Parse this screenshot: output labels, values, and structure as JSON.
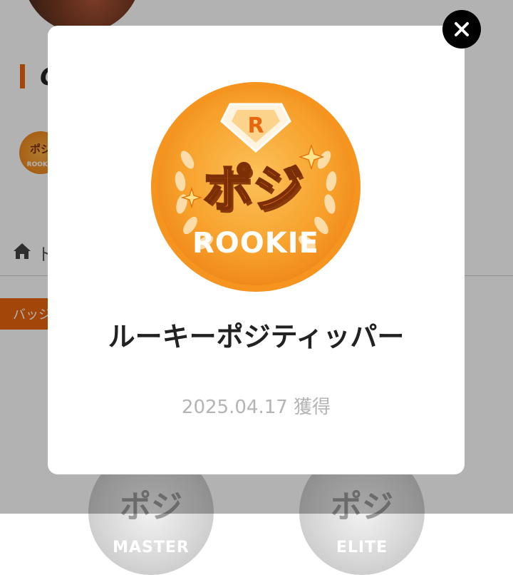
{
  "background": {
    "heading": "C",
    "mini_badge": {
      "glyph": "ポジ",
      "text": "ROOKIE"
    },
    "nav": {
      "home_label": "ト"
    },
    "tab_pill": "バッジ",
    "locked_badges": [
      {
        "glyph": "ポジ",
        "label": "MASTER"
      },
      {
        "glyph": "ポジ",
        "label": "ELITE"
      }
    ]
  },
  "modal": {
    "badge": {
      "rank_letter": "R",
      "katakana": "ポジ",
      "word": "ROOKIE"
    },
    "title": "ルーキーポジティッパー",
    "date": "2025.04.17 獲得"
  },
  "colors": {
    "accent": "#e8660e",
    "badge_outer": "#f7a62a",
    "badge_inner": "#fbb945",
    "text_dark": "#222222",
    "text_muted": "#b4b4b4"
  },
  "icons": {
    "close": "close-icon",
    "home": "home-icon"
  }
}
